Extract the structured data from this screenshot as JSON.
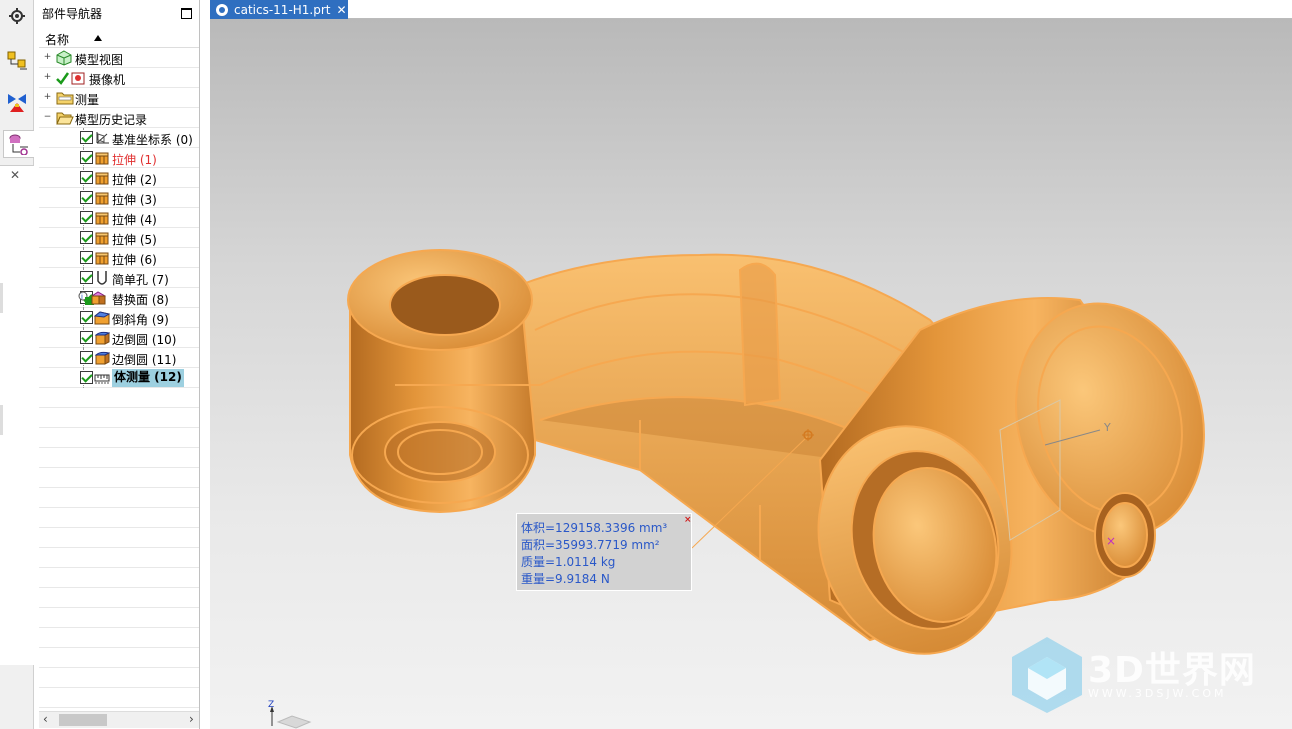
{
  "navigator": {
    "title": "部件导航器",
    "column_header": "名称",
    "items": [
      {
        "label": "模型视图",
        "icon": "model-views-icon",
        "level": 0,
        "expand": "+"
      },
      {
        "label": "摄像机",
        "icon": "camera-icon",
        "level": 0,
        "expand": "+"
      },
      {
        "label": "测量",
        "icon": "folder-icon",
        "level": 0,
        "expand": "+"
      },
      {
        "label": "模型历史记录",
        "icon": "folder-open-icon",
        "level": 0,
        "expand": "−"
      },
      {
        "label": "基准坐标系 (0)",
        "icon": "datum-csys-icon",
        "level": 1
      },
      {
        "label": "拉伸 (1)",
        "icon": "extrude-icon",
        "level": 1,
        "red": true
      },
      {
        "label": "拉伸 (2)",
        "icon": "extrude-icon",
        "level": 1
      },
      {
        "label": "拉伸 (3)",
        "icon": "extrude-icon",
        "level": 1
      },
      {
        "label": "拉伸 (4)",
        "icon": "extrude-icon",
        "level": 1
      },
      {
        "label": "拉伸 (5)",
        "icon": "extrude-icon",
        "level": 1
      },
      {
        "label": "拉伸 (6)",
        "icon": "extrude-icon",
        "level": 1
      },
      {
        "label": "简单孔 (7)",
        "icon": "hole-icon",
        "level": 1
      },
      {
        "label": "替换面 (8)",
        "icon": "replace-face-icon",
        "level": 1
      },
      {
        "label": "倒斜角 (9)",
        "icon": "chamfer-icon",
        "level": 1
      },
      {
        "label": "边倒圆 (10)",
        "icon": "edge-blend-icon",
        "level": 1
      },
      {
        "label": "边倒圆 (11)",
        "icon": "edge-blend-icon",
        "level": 1
      },
      {
        "label": "体测量 (12)",
        "icon": "measure-body-icon",
        "level": 1,
        "selected": true
      }
    ]
  },
  "tab": {
    "label": "catics-11-H1.prt",
    "close": "✕"
  },
  "measure": {
    "volume": "体积=129158.3396 mm³",
    "area": "面积=35993.7719 mm²",
    "mass": "质量=1.0114 kg",
    "weight": "重量=9.9184 N",
    "close": "×"
  },
  "axis": {
    "y": "Y",
    "z": "Z"
  },
  "watermark": {
    "brand": "3D世界网",
    "url": "WWW.3DSJW.COM"
  },
  "colors": {
    "part": "#f5a845",
    "accent": "#2f6fc0",
    "info_text": "#2a58c8",
    "selection": "#9dd0e0"
  }
}
